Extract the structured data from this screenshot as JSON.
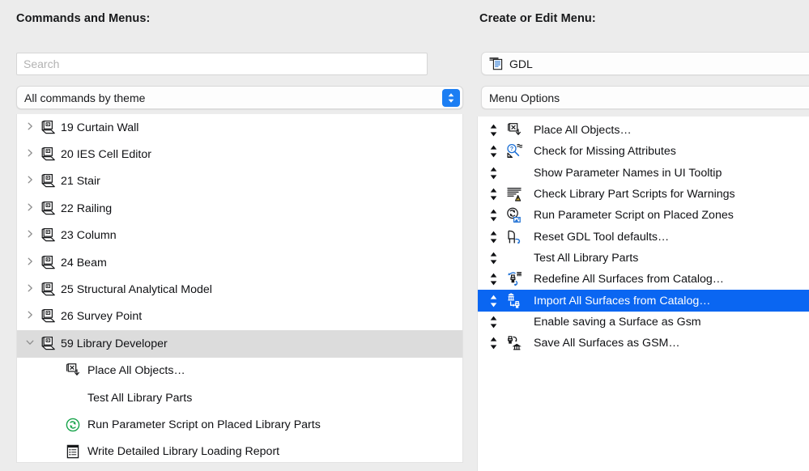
{
  "left": {
    "title": "Commands and Menus:",
    "search": {
      "placeholder": "Search",
      "value": "",
      "icon": "search-input"
    },
    "theme_dropdown": {
      "selected": "All commands by theme",
      "icon": "stepper-updown-icon",
      "accent_color": "#1c7ef3"
    },
    "tree_items": [
      {
        "label": "19 Curtain Wall",
        "level": 0,
        "expanded": false,
        "icon": "menu-folder-icon",
        "selected": false
      },
      {
        "label": "20 IES Cell Editor",
        "level": 0,
        "expanded": false,
        "icon": "menu-folder-icon",
        "selected": false
      },
      {
        "label": "21 Stair",
        "level": 0,
        "expanded": false,
        "icon": "menu-folder-icon",
        "selected": false
      },
      {
        "label": "22 Railing",
        "level": 0,
        "expanded": false,
        "icon": "menu-folder-icon",
        "selected": false
      },
      {
        "label": "23 Column",
        "level": 0,
        "expanded": false,
        "icon": "menu-folder-icon",
        "selected": false
      },
      {
        "label": "24 Beam",
        "level": 0,
        "expanded": false,
        "icon": "menu-folder-icon",
        "selected": false
      },
      {
        "label": "25 Structural Analytical Model",
        "level": 0,
        "expanded": false,
        "icon": "menu-folder-icon",
        "selected": false
      },
      {
        "label": "26 Survey Point",
        "level": 0,
        "expanded": false,
        "icon": "menu-folder-icon",
        "selected": false
      },
      {
        "label": "59 Library Developer",
        "level": 0,
        "expanded": true,
        "icon": "menu-folder-icon",
        "selected": true
      },
      {
        "label": "Place All Objects…",
        "level": 1,
        "icon": "place-all-objects-icon",
        "selected": false
      },
      {
        "label": "Test All Library Parts",
        "level": 1,
        "icon": "none",
        "selected": false
      },
      {
        "label": "Run Parameter Script on Placed Library Parts",
        "level": 1,
        "icon": "run-parameter-script-icon",
        "selected": false
      },
      {
        "label": "Write Detailed Library Loading Report",
        "level": 1,
        "icon": "report-list-icon",
        "selected": false
      }
    ]
  },
  "right": {
    "title": "Create or Edit Menu:",
    "menu_name_field": {
      "value": "GDL",
      "icon": "menu-definition-icon"
    },
    "menu_options_field": {
      "value": "Menu Options"
    },
    "selection_color": "#0a66f2",
    "menu_items": [
      {
        "label": "Place All Objects…",
        "icon": "place-all-objects-icon",
        "selected": false,
        "handle": "sort-updown-icon"
      },
      {
        "label": "Check for Missing Attributes",
        "icon": "check-missing-attributes-icon",
        "selected": false,
        "handle": "sort-updown-icon"
      },
      {
        "label": "Show Parameter Names in UI Tooltip",
        "icon": "none",
        "selected": false,
        "handle": "sort-updown-icon"
      },
      {
        "label": "Check Library Part Scripts for Warnings",
        "icon": "script-warning-icon",
        "selected": false,
        "handle": "sort-updown-icon"
      },
      {
        "label": "Run Parameter Script on Placed Zones",
        "icon": "run-script-zones-icon",
        "selected": false,
        "handle": "sort-updown-icon"
      },
      {
        "label": "Reset GDL Tool defaults…",
        "icon": "reset-gdl-tool-icon",
        "selected": false,
        "handle": "sort-updown-icon"
      },
      {
        "label": "Test All Library Parts",
        "icon": "none",
        "selected": false,
        "handle": "sort-updown-icon"
      },
      {
        "label": "Redefine All Surfaces from Catalog…",
        "icon": "redefine-surfaces-icon",
        "selected": false,
        "handle": "sort-updown-icon"
      },
      {
        "label": "Import All Surfaces from Catalog…",
        "icon": "import-surfaces-icon",
        "selected": true,
        "handle": "sort-updown-icon"
      },
      {
        "label": "Enable saving a Surface as Gsm",
        "icon": "none",
        "selected": false,
        "handle": "sort-updown-icon"
      },
      {
        "label": "Save All Surfaces as GSM…",
        "icon": "save-surfaces-gsm-icon",
        "selected": false,
        "handle": "sort-updown-icon"
      }
    ]
  }
}
